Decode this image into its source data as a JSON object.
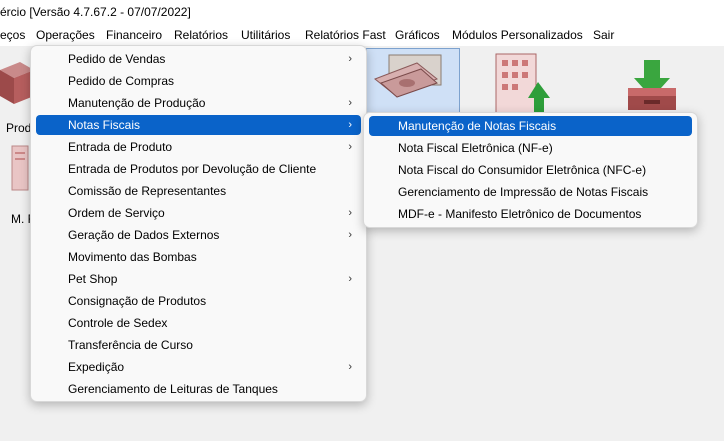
{
  "window": {
    "title": "ércio [Versão 4.7.67.2 - 07/07/2022]"
  },
  "menubar": {
    "items": [
      "eços",
      "Operações",
      "Financeiro",
      "Relatórios",
      "Utilitários",
      "Relatórios Fast",
      "Gráficos",
      "Módulos Personalizados",
      "Sair"
    ]
  },
  "desktop": {
    "tile_labels": [
      "Prod",
      "M. F"
    ]
  },
  "operacoes_menu": {
    "items": [
      {
        "label": "Pedido de Vendas",
        "submenu": true
      },
      {
        "label": "Pedido de Compras",
        "submenu": false
      },
      {
        "label": "Manutenção de Produção",
        "submenu": true
      },
      {
        "label": "Notas Fiscais",
        "submenu": true,
        "active": true
      },
      {
        "label": "Entrada de Produto",
        "submenu": true
      },
      {
        "label": "Entrada de Produtos por Devolução de Cliente",
        "submenu": false
      },
      {
        "label": "Comissão de Representantes",
        "submenu": false
      },
      {
        "label": "Ordem de Serviço",
        "submenu": true
      },
      {
        "label": "Geração de Dados Externos",
        "submenu": true
      },
      {
        "label": "Movimento das Bombas",
        "submenu": false
      },
      {
        "label": "Pet Shop",
        "submenu": true
      },
      {
        "label": "Consignação de Produtos",
        "submenu": false
      },
      {
        "label": "Controle de Sedex",
        "submenu": false
      },
      {
        "label": "Transferência de Curso",
        "submenu": false
      },
      {
        "label": "Expedição",
        "submenu": true
      },
      {
        "label": "Gerenciamento de Leituras de Tanques",
        "submenu": false
      }
    ]
  },
  "notas_fiscais_submenu": {
    "items": [
      {
        "label": "Manutenção de Notas Fiscais",
        "active": true
      },
      {
        "label": "Nota Fiscal Eletrônica (NF-e)"
      },
      {
        "label": "Nota Fiscal do Consumidor Eletrônica (NFC-e)"
      },
      {
        "label": "Gerenciamento de Impressão de Notas Fiscais"
      },
      {
        "label": "MDF-e - Manifesto Eletrônico de Documentos"
      }
    ]
  },
  "submenu_arrow": "›",
  "colors": {
    "highlight": "#0a63c9",
    "menu_bg": "#f9f9f9"
  }
}
